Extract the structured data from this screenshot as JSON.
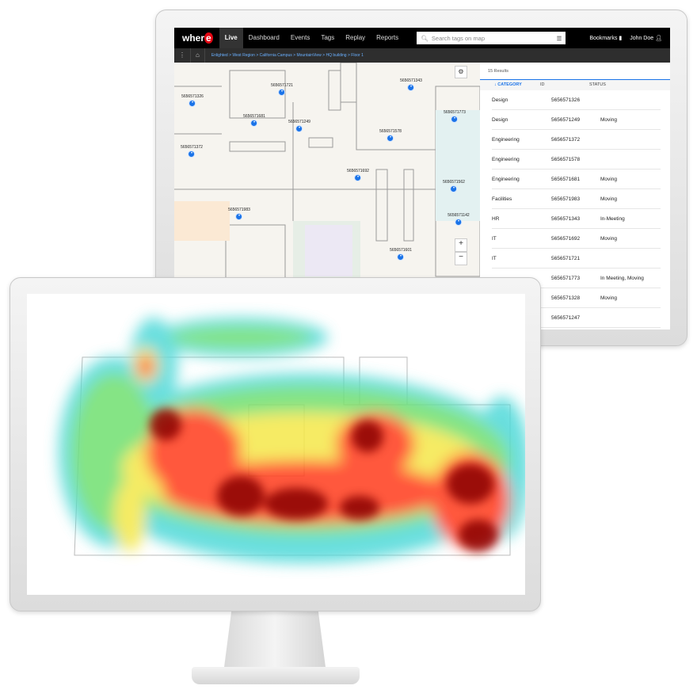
{
  "nav": {
    "logo": "where",
    "tabs": [
      "Live",
      "Dashboard",
      "Events",
      "Tags",
      "Replay",
      "Reports"
    ],
    "active": "Live",
    "search_placeholder": "Search tags on map",
    "bookmarks": "Bookmarks",
    "user": "John Doe"
  },
  "breadcrumb": "Enlighted > West Region > California Campus > MountainView > HQ building > Floor 1",
  "map": {
    "markers": [
      "5656571721",
      "5656571326",
      "5656571681",
      "5656571249",
      "5656571578",
      "5656571372",
      "5656571692",
      "5656571983",
      "5656571601",
      "5656571343",
      "5656571773",
      "5656571562",
      "5656571142"
    ],
    "zoom_in": "+",
    "zoom_out": "−"
  },
  "panel": {
    "results": "15 Results",
    "headers": [
      "↓ CATEGORY",
      "ID",
      "STATUS"
    ],
    "rows": [
      [
        "Design",
        "5656571326",
        ""
      ],
      [
        "Design",
        "5656571249",
        "Moving"
      ],
      [
        "Engineering",
        "5656571372",
        ""
      ],
      [
        "Engineering",
        "5656571578",
        ""
      ],
      [
        "Engineering",
        "5656571681",
        "Moving"
      ],
      [
        "Facilities",
        "5656571983",
        "Moving"
      ],
      [
        "HR",
        "5656571343",
        "In-Meeting"
      ],
      [
        "IT",
        "5656571692",
        "Moving"
      ],
      [
        "IT",
        "5656571721",
        ""
      ],
      [
        "",
        "5656571773",
        "In Meeting, Moving"
      ],
      [
        "",
        "5656571328",
        "Moving"
      ],
      [
        "",
        "5656571247",
        ""
      ]
    ]
  },
  "colors": {
    "accent": "#1a73e8",
    "brand_red": "#e30613"
  }
}
